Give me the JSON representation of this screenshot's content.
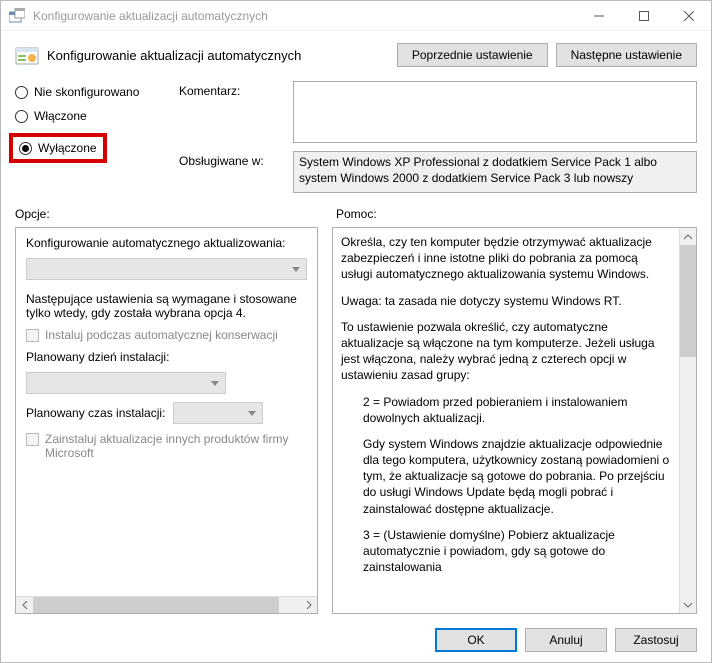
{
  "window": {
    "title": "Konfigurowanie aktualizacji automatycznych"
  },
  "header": {
    "title": "Konfigurowanie aktualizacji automatycznych",
    "prev_label": "Poprzednie ustawienie",
    "next_label": "Następne ustawienie"
  },
  "radios": {
    "not_configured": "Nie skonfigurowano",
    "enabled": "Włączone",
    "disabled": "Wyłączone",
    "selected": "disabled"
  },
  "fields": {
    "comment_label": "Komentarz:",
    "comment_value": "",
    "supported_label": "Obsługiwane w:",
    "supported_value": "System Windows XP Professional z dodatkiem Service Pack 1 albo system Windows 2000 z dodatkiem Service Pack 3 lub nowszy"
  },
  "sections": {
    "options_label": "Opcje:",
    "help_label": "Pomoc:"
  },
  "options": {
    "title": "Konfigurowanie automatycznego aktualizowania:",
    "note": "Następujące ustawienia są wymagane i stosowane tylko wtedy, gdy została wybrana opcja 4.",
    "chk_install_maint": "Instaluj podczas automatycznej konserwacji",
    "day_label": "Planowany dzień instalacji:",
    "time_label": "Planowany czas instalacji:",
    "chk_other_products": "Zainstaluj aktualizacje innych produktów firmy Microsoft"
  },
  "help": {
    "p1": "Określa, czy ten komputer będzie otrzymywać aktualizacje zabezpieczeń i inne istotne pliki do pobrania za pomocą usługi automatycznego aktualizowania systemu Windows.",
    "p2": "Uwaga: ta zasada nie dotyczy systemu Windows RT.",
    "p3": "To ustawienie pozwala określić, czy automatyczne aktualizacje są włączone na tym komputerze. Jeżeli usługa jest włączona, należy wybrać jedną z czterech opcji w ustawieniu zasad grupy:",
    "p4": "2 = Powiadom przed pobieraniem i instalowaniem dowolnych aktualizacji.",
    "p5": "Gdy system Windows znajdzie aktualizacje odpowiednie dla tego komputera, użytkownicy zostaną powiadomieni o tym, że aktualizacje są gotowe do pobrania. Po przejściu do usługi Windows Update będą mogli pobrać i zainstalować dostępne aktualizacje.",
    "p6": "3 = (Ustawienie domyślne) Pobierz aktualizacje automatycznie i powiadom, gdy są gotowe do zainstalowania"
  },
  "footer": {
    "ok": "OK",
    "cancel": "Anuluj",
    "apply": "Zastosuj"
  }
}
